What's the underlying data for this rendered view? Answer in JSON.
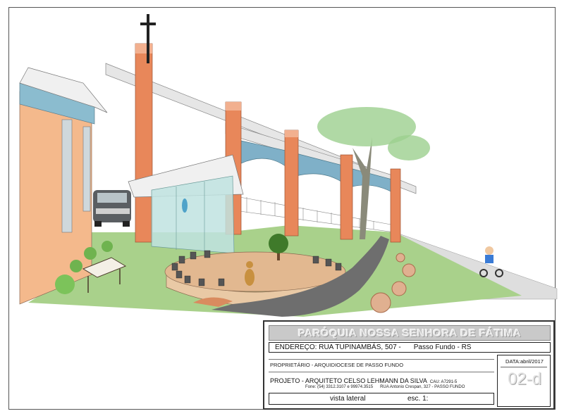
{
  "drawing": {
    "title": "PARÓQUIA NOSSA SENHORA DE FÁTIMA",
    "address": "ENDEREÇO: RUA TUPINAMBÁS, 507 -",
    "city": "Passo Fundo - RS",
    "owner": "PROPRIETÁRIO - ARQUIDIOCESE DE PASSO FUNDO",
    "project": "PROJETO - ARQUITETO CELSO LEHMANN DA SILVA",
    "cau": "CAU: A7291-5",
    "phone": "Fone: (54) 3312.3107 e 99974.3515",
    "street": "RUA Antonio Crespan, 327 - PASSO FUNDO",
    "view": "vista lateral",
    "scale": "esc. 1:",
    "date": "DATA:abril/2017",
    "sheet_number": "02-d"
  },
  "colors": {
    "pillar": "#e8875a",
    "beam": "#e6e6e6",
    "arch": "#7fb0c8",
    "lawn": "#a9d18b",
    "path": "#6e6e6e",
    "plaza": "#e2b890",
    "glass": "#bfe3e0",
    "house_wall": "#f4b98c",
    "roof_band": "#8bbccf"
  },
  "icons": [
    "cross-icon",
    "car-icon",
    "bench-icon",
    "tree-icon",
    "dog-icon",
    "child-tricycle-icon"
  ]
}
